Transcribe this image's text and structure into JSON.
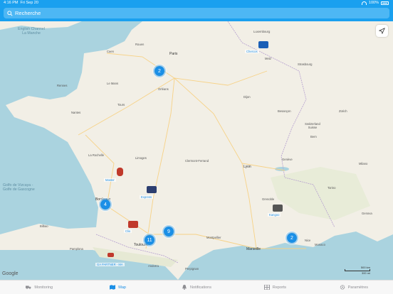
{
  "status": {
    "time": "4:16 PM",
    "date": "Fri Sep 20",
    "battery": "100%"
  },
  "search": {
    "placeholder": "Recherche"
  },
  "map_labels": {
    "sea_channel": "English Channel\nLa Manche",
    "sea_biscay": "Golfe de Gascogne",
    "sea_biscay2": "Golfo de Vizcaya -",
    "paris": "Paris",
    "luxembourg": "Luxembourg",
    "strasbourg": "Strasbourg",
    "nantes": "Nantes",
    "bordeaux": "Bordeaux",
    "toulouse": "Toulouse",
    "lyon": "Lyon",
    "marseille": "Marseille",
    "geneva": "Genève",
    "orleans": "Orléans",
    "limoges": "Limoges",
    "metz": "Metz",
    "dijon": "Dijon",
    "nice": "Nice",
    "montpellier": "Montpellier",
    "rennes": "Rennes",
    "caen": "Caen",
    "rouen": "Rouen",
    "le_mans": "Le Mans",
    "tours": "Tours",
    "clermont": "Clermont-Ferrand",
    "grenoble": "Grenoble",
    "besancon": "Besançon",
    "la_rochelle": "La Rochelle",
    "perpignan": "Perpignan",
    "andorra": "Andorra",
    "zurich": "Zürich",
    "bern": "Bern",
    "switzerland": "Switzerland\nSuisse",
    "milan": "Milano",
    "turin": "Torino",
    "genova": "Genova",
    "monaco": "Monaco",
    "bilbao": "Bilbao",
    "pamplona": "Pamplona"
  },
  "clusters": [
    {
      "id": "paris",
      "count": "2"
    },
    {
      "id": "bordeaux",
      "count": "4"
    },
    {
      "id": "toulouse",
      "count": "11"
    },
    {
      "id": "albi",
      "count": "9"
    },
    {
      "id": "nice",
      "count": "2"
    }
  ],
  "vehicles": [
    {
      "id": "lux",
      "label": "Chercos",
      "color": "#1b5fb6"
    },
    {
      "id": "bx",
      "label": "Master",
      "color": "#c0392b"
    },
    {
      "id": "lim",
      "label": "Express",
      "color": "#2c3e70"
    },
    {
      "id": "tlse",
      "label": "Clio",
      "color": "#c0392b"
    },
    {
      "id": "sea",
      "label": "GA PARTNER - MA",
      "color": "#c0392b"
    },
    {
      "id": "alps",
      "label": "Kangoo",
      "color": "#555"
    }
  ],
  "attribution": "Google",
  "scale": {
    "top": "500 km",
    "bottom": "300 mi"
  },
  "tabs": [
    {
      "label": "Monitoring",
      "icon": "truck-icon"
    },
    {
      "label": "Map",
      "icon": "map-icon"
    },
    {
      "label": "Notifications",
      "icon": "bell-icon"
    },
    {
      "label": "Reports",
      "icon": "grid-icon"
    },
    {
      "label": "Paramètres",
      "icon": "gear-icon"
    }
  ],
  "colors": {
    "accent": "#1aa0ef",
    "land": "#f2efe6",
    "sea": "#aad3df",
    "cluster": "#1b8fe6"
  }
}
